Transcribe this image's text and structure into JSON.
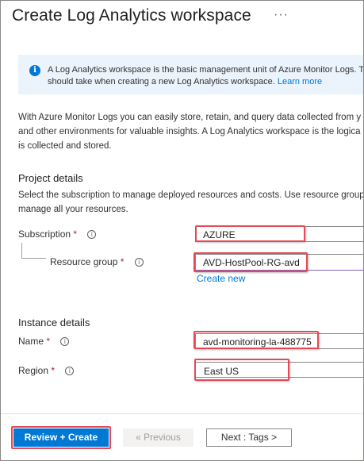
{
  "header": {
    "title": "Create Log Analytics workspace",
    "more_icon": "ellipsis-icon"
  },
  "info": {
    "icon": "info-icon",
    "line1": "A Log Analytics workspace is the basic management unit of Azure Monitor Logs. The",
    "line2": "should take when creating a new Log Analytics workspace.",
    "link": "Learn more"
  },
  "intro": {
    "line1": "With Azure Monitor Logs you can easily store, retain, and query data collected from y",
    "line2": "and other environments for valuable insights. A Log Analytics workspace is the logica",
    "line3": "is collected and stored."
  },
  "project": {
    "heading": "Project details",
    "desc1": "Select the subscription to manage deployed resources and costs. Use resource group",
    "desc2": "manage all your resources.",
    "subscription_label": "Subscription",
    "subscription_value": "AZURE",
    "resource_group_label": "Resource group",
    "resource_group_value": "AVD-HostPool-RG-avd",
    "create_new": "Create new",
    "required_mark": "*",
    "help_glyph": "i"
  },
  "instance": {
    "heading": "Instance details",
    "name_label": "Name",
    "name_value": "avd-monitoring-la-488775",
    "region_label": "Region",
    "region_value": "East US"
  },
  "footer": {
    "review_create": "Review + Create",
    "previous": "« Previous",
    "next": "Next : Tags >"
  },
  "colors": {
    "primary": "#0078d4",
    "highlight": "#e74856",
    "required": "#a4262c",
    "info_bg": "#ebf3fc"
  }
}
